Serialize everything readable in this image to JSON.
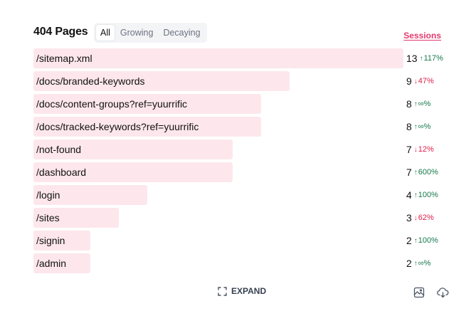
{
  "header": {
    "title": "404 Pages",
    "tabs": [
      {
        "label": "All",
        "active": true
      },
      {
        "label": "Growing",
        "active": false
      },
      {
        "label": "Decaying",
        "active": false
      }
    ],
    "sessions_label": "Sessions"
  },
  "colors": {
    "bar": "#fde7ec",
    "accent": "#e3396e",
    "up": "#16794c",
    "down": "#e11d48"
  },
  "rows": [
    {
      "path": "/sitemap.xml",
      "count": "13",
      "direction": "up",
      "change": "117%",
      "share": 1.0
    },
    {
      "path": "/docs/branded-keywords",
      "count": "9",
      "direction": "down",
      "change": "47%",
      "share": 0.6923
    },
    {
      "path": "/docs/content-groups?ref=yuurrific",
      "count": "8",
      "direction": "up",
      "change": "∞%",
      "share": 0.6154
    },
    {
      "path": "/docs/tracked-keywords?ref=yuurrific",
      "count": "8",
      "direction": "up",
      "change": "∞%",
      "share": 0.6154
    },
    {
      "path": "/not-found",
      "count": "7",
      "direction": "down",
      "change": "12%",
      "share": 0.5385
    },
    {
      "path": "/dashboard",
      "count": "7",
      "direction": "up",
      "change": "600%",
      "share": 0.5385
    },
    {
      "path": "/login",
      "count": "4",
      "direction": "up",
      "change": "100%",
      "share": 0.3077
    },
    {
      "path": "/sites",
      "count": "3",
      "direction": "down",
      "change": "62%",
      "share": 0.2308
    },
    {
      "path": "/signin",
      "count": "2",
      "direction": "up",
      "change": "100%",
      "share": 0.1538
    },
    {
      "path": "/admin",
      "count": "2",
      "direction": "up",
      "change": "∞%",
      "share": 0.1538
    }
  ],
  "footer": {
    "expand_label": "EXPAND",
    "expand_icon": "expand-icon",
    "image_icon": "image-icon",
    "download_icon": "cloud-download-icon"
  }
}
